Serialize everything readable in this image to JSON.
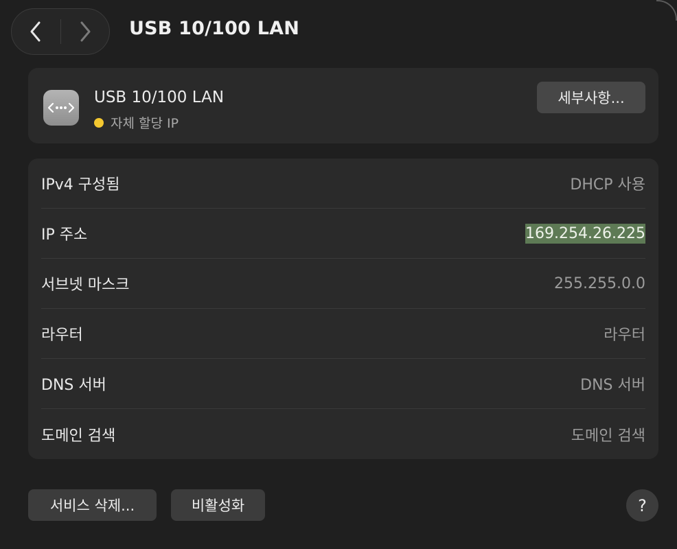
{
  "header": {
    "title": "USB 10/100 LAN"
  },
  "interface": {
    "name": "USB 10/100 LAN",
    "status": "자체 할당 IP",
    "status_color": "#f4c830",
    "details_label": "세부사항..."
  },
  "info_rows": [
    {
      "label": "IPv4 구성됨",
      "value": "DHCP 사용"
    },
    {
      "label": "IP 주소",
      "value": "169.254.26.225"
    },
    {
      "label": "서브넷 마스크",
      "value": "255.255.0.0"
    },
    {
      "label": "라우터",
      "value": "라우터"
    },
    {
      "label": "DNS 서버",
      "value": "DNS 서버"
    },
    {
      "label": "도메인 검색",
      "value": "도메인 검색"
    }
  ],
  "footer": {
    "delete_service_label": "서비스 삭제...",
    "deactivate_label": "비활성화",
    "help_label": "?"
  },
  "icons": {
    "back": "chevron-left-icon",
    "forward": "chevron-right-icon",
    "interface": "ethernet-icon"
  },
  "colors": {
    "background": "#1f1f1f",
    "card": "#2a2a2a",
    "selection": "#5e7a55"
  }
}
